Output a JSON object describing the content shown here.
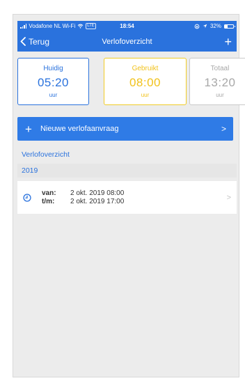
{
  "status_bar": {
    "carrier": "Vodafone NL Wi-Fi",
    "network": "LTE",
    "time": "18:54",
    "battery": "32%",
    "battery_level": 0.32
  },
  "nav": {
    "back_label": "Terug",
    "title": "Verlofoverzicht",
    "add_label": "+"
  },
  "totals": {
    "current": {
      "label": "Huidig",
      "value": "05:20",
      "unit": "uur"
    },
    "used": {
      "label": "Gebruikt",
      "value": "08:00",
      "unit": "uur"
    },
    "total": {
      "label": "Totaal",
      "value": "13:20",
      "unit": "uur"
    }
  },
  "new_request": {
    "plus": "+",
    "label": "Nieuwe verlofaanvraag",
    "chevron": ">"
  },
  "overview": {
    "section_title": "Verlofoverzicht",
    "year": "2019",
    "items": [
      {
        "icon": "clock-icon",
        "from_label": "van:",
        "from_value": "2 okt. 2019 08:00",
        "to_label": "t/m:",
        "to_value": "2 okt. 2019 17:00",
        "chevron": ">"
      }
    ]
  },
  "colors": {
    "primary": "#2a72dd",
    "used_accent": "#f1c21b",
    "total_accent": "#a8a8a8",
    "background": "#ececec"
  }
}
